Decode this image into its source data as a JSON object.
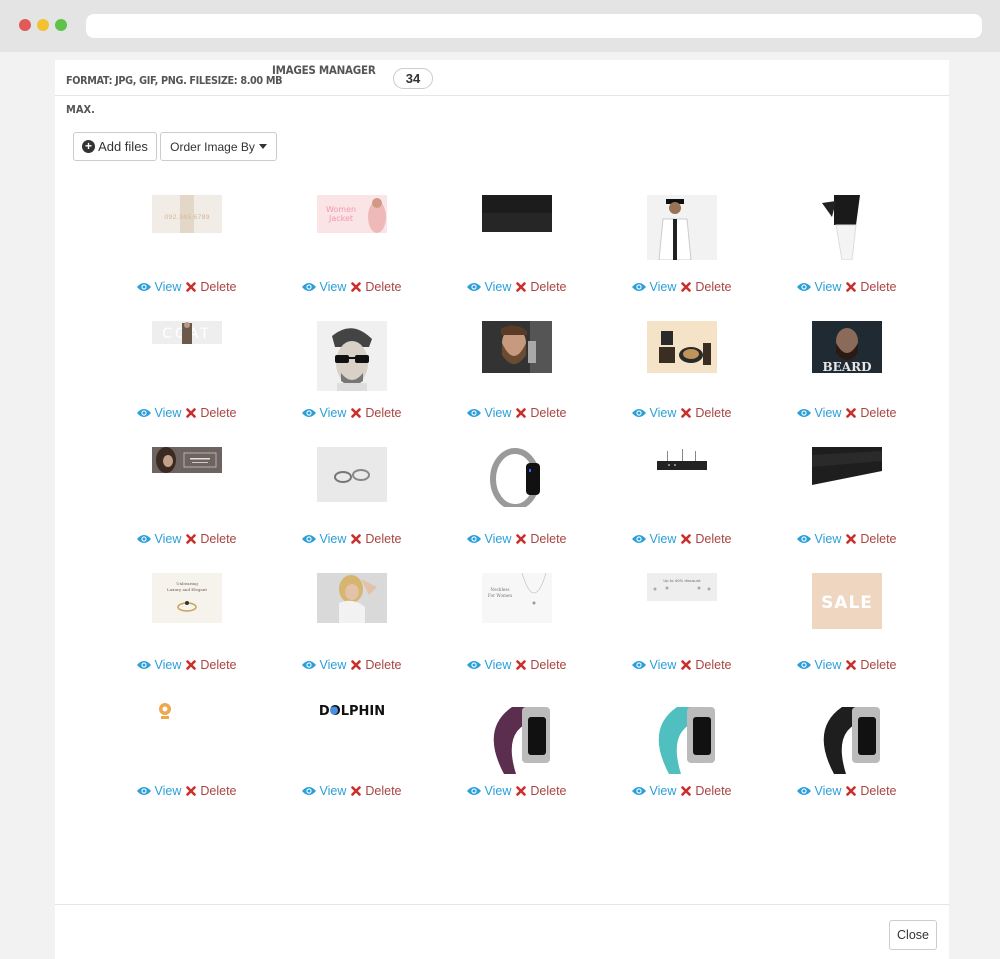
{
  "header": {
    "format_text": "FORMAT: JPG, GIF, PNG. FILESIZE: 8.00 MB",
    "max_text": "MAX.",
    "manager_label": "IMAGES MANAGER",
    "count": "34"
  },
  "toolbar": {
    "add_files_label": "Add files",
    "order_label": "Order Image By"
  },
  "actions": {
    "view_label": "View",
    "delete_label": "Delete"
  },
  "images": [
    {
      "icon": "phone-banner-image",
      "text": "092.345.6789"
    },
    {
      "icon": "women-jacket-banner-image",
      "text": "Women Jacket"
    },
    {
      "icon": "dark-banner-image",
      "text": ""
    },
    {
      "icon": "man-white-jacket-image",
      "text": ""
    },
    {
      "icon": "leather-jacket-image",
      "text": ""
    },
    {
      "icon": "coat-banner-image",
      "text": "COAT"
    },
    {
      "icon": "man-sunglasses-image",
      "text": ""
    },
    {
      "icon": "bearded-man-image",
      "text": ""
    },
    {
      "icon": "beard-products-image",
      "text": ""
    },
    {
      "icon": "beard-banner-image",
      "text": "BEARD"
    },
    {
      "icon": "beauty-banner-image",
      "text": ""
    },
    {
      "icon": "rings-image",
      "text": ""
    },
    {
      "icon": "silver-band-image",
      "text": ""
    },
    {
      "icon": "black-device-image",
      "text": ""
    },
    {
      "icon": "dark-slant-banner-image",
      "text": ""
    },
    {
      "icon": "ring-banner-image",
      "text": "Unbearing Luxury and Elegant"
    },
    {
      "icon": "blonde-woman-image",
      "text": ""
    },
    {
      "icon": "necklace-image",
      "text": "Neckless For Women"
    },
    {
      "icon": "earrings-banner-image",
      "text": "Up to 40% discount"
    },
    {
      "icon": "sale-banner-image",
      "text": "SALE"
    },
    {
      "icon": "dolphin-icon-image",
      "text": ""
    },
    {
      "icon": "dolphin-logo-image",
      "text": "DOLPHIN"
    },
    {
      "icon": "purple-band-image",
      "text": ""
    },
    {
      "icon": "teal-band-image",
      "text": ""
    },
    {
      "icon": "black-band-image",
      "text": ""
    }
  ],
  "footer": {
    "close_label": "Close"
  },
  "colors": {
    "link_blue": "#2a9fd8",
    "delete_red": "#c9302c"
  }
}
